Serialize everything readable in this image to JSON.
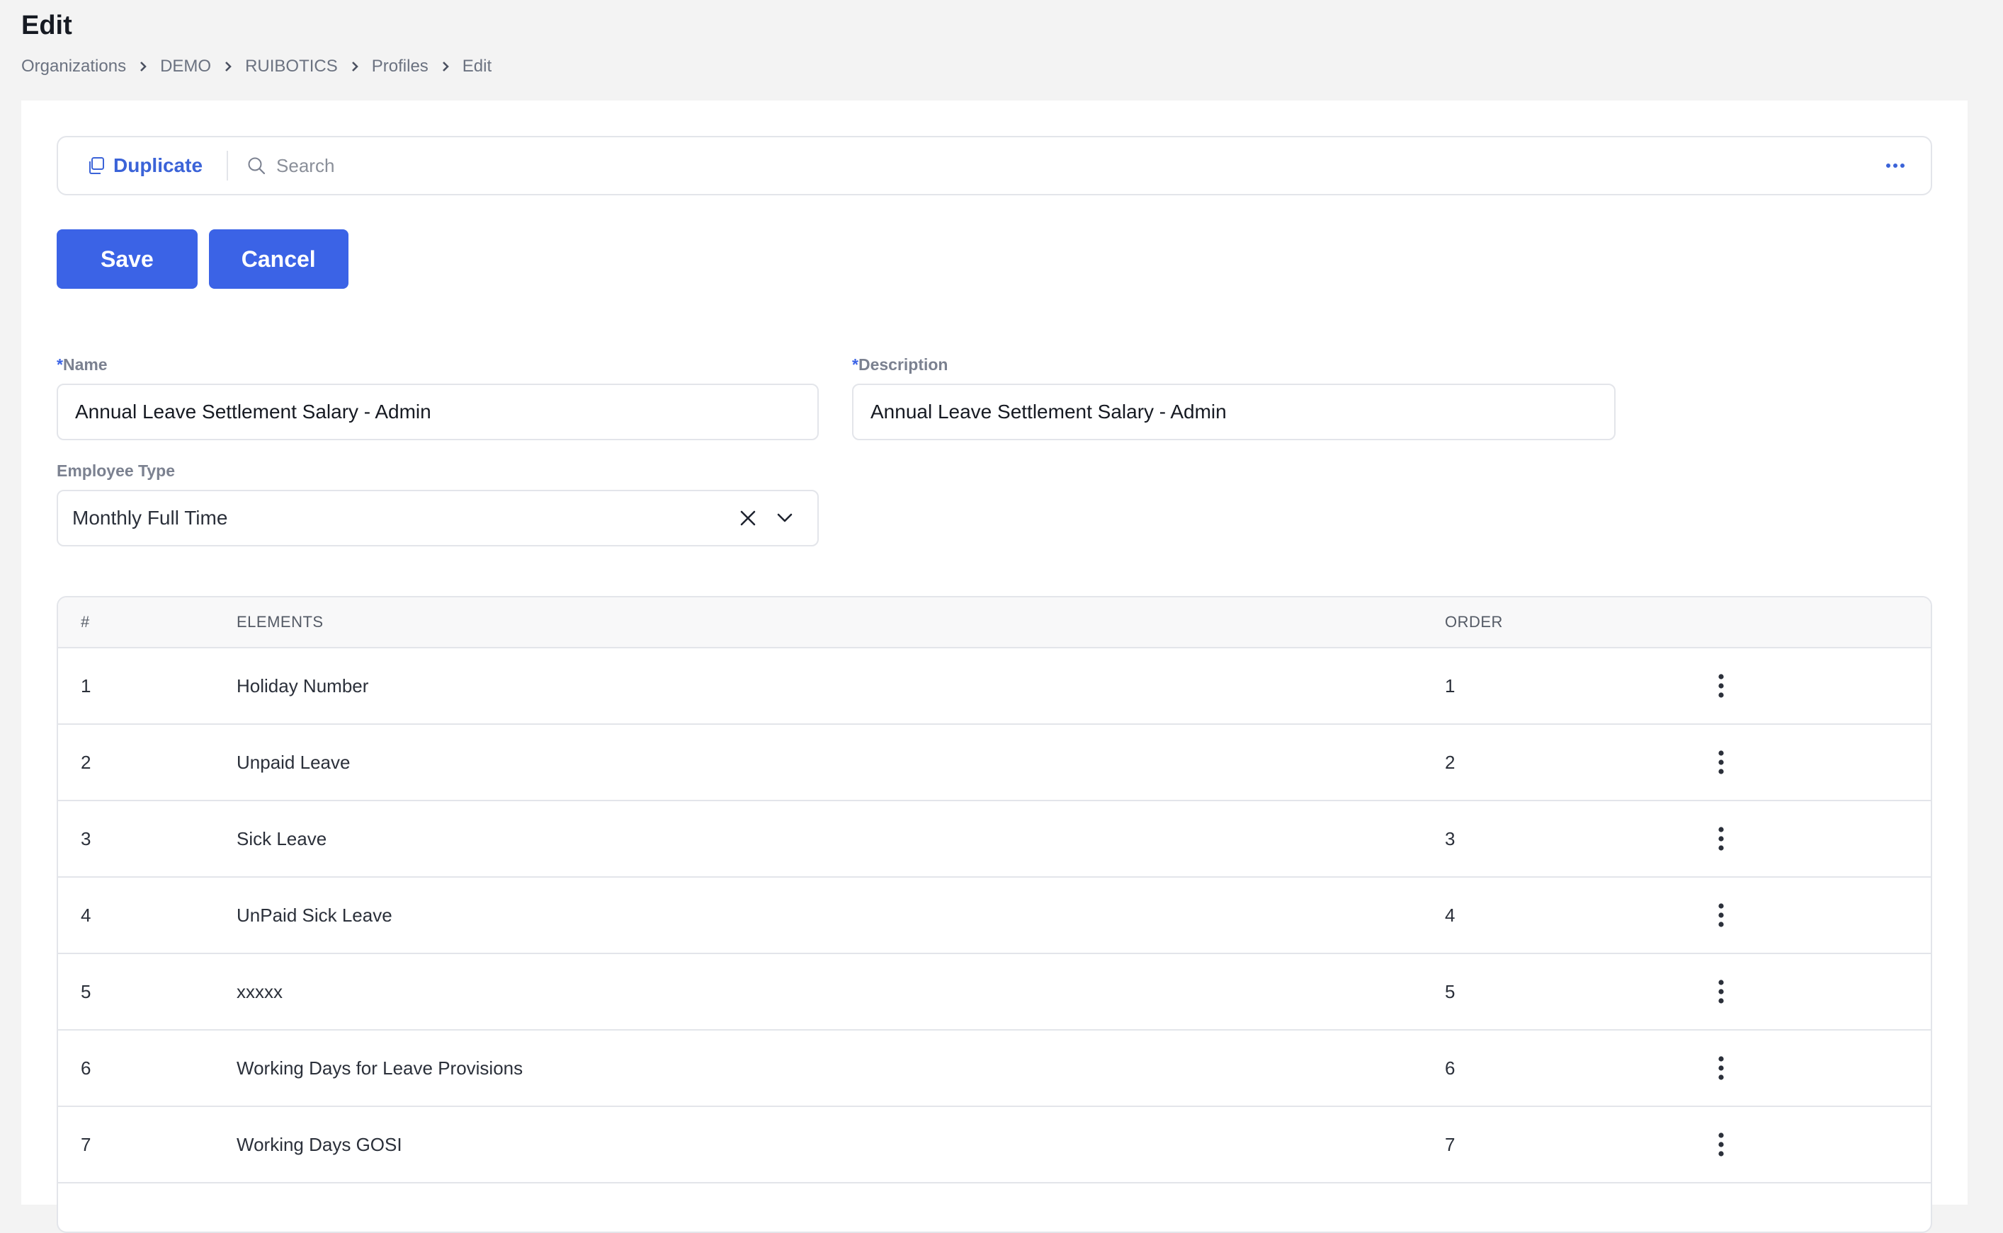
{
  "header": {
    "title": "Edit",
    "breadcrumb": [
      "Organizations",
      "DEMO",
      "RUIBOTICS",
      "Profiles",
      "Edit"
    ]
  },
  "toolbar": {
    "duplicate_label": "Duplicate",
    "search_placeholder": "Search",
    "more_icon": "more-horizontal-icon"
  },
  "actions": {
    "save_label": "Save",
    "cancel_label": "Cancel"
  },
  "form": {
    "name": {
      "required_mark": "*",
      "label": "Name",
      "value": "Annual Leave Settlement Salary - Admin"
    },
    "description": {
      "required_mark": "*",
      "label": "Description",
      "value": "Annual Leave Settlement Salary - Admin"
    },
    "employee_type": {
      "label": "Employee Type",
      "value": "Monthly Full Time"
    }
  },
  "table": {
    "columns": [
      "#",
      "ELEMENTS",
      "ORDER"
    ],
    "rows": [
      {
        "num": "1",
        "element": "Holiday Number",
        "order": "1"
      },
      {
        "num": "2",
        "element": "Unpaid Leave",
        "order": "2"
      },
      {
        "num": "3",
        "element": "Sick Leave",
        "order": "3"
      },
      {
        "num": "4",
        "element": "UnPaid Sick Leave",
        "order": "4"
      },
      {
        "num": "5",
        "element": "xxxxx",
        "order": "5"
      },
      {
        "num": "6",
        "element": "Working Days for Leave Provisions",
        "order": "6"
      },
      {
        "num": "7",
        "element": "Working Days GOSI",
        "order": "7"
      }
    ]
  },
  "colors": {
    "accent": "#3b63e6",
    "page_bg": "#f3f3f3",
    "border": "#e3e5ea"
  }
}
